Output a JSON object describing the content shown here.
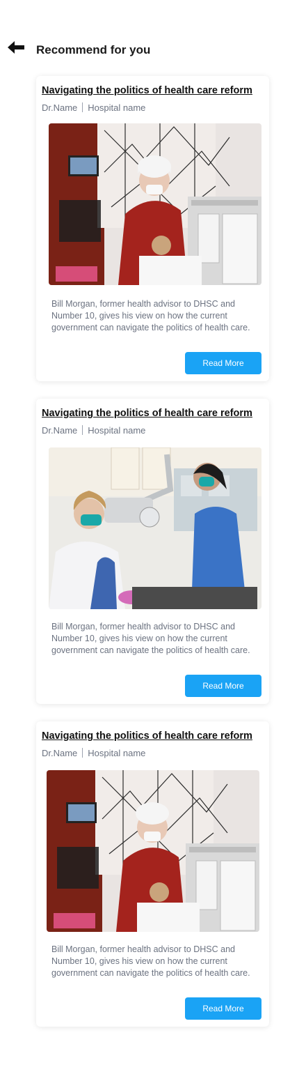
{
  "header": {
    "title": "Recommend for you",
    "back_icon": "arrow-left-icon"
  },
  "articles": [
    {
      "title": "Navigating the politics of health care reform",
      "doctor": "Dr.Name",
      "hospital": "Hospital name",
      "image": "dental-clinic-photo-1",
      "description": "Bill Morgan, former health advisor to DHSC and Number 10, gives his view on how the current government can navigate the politics of health care.",
      "button_label": "Read More"
    },
    {
      "title": "Navigating the politics of health care reform",
      "doctor": "Dr.Name",
      "hospital": "Hospital name",
      "image": "dental-clinic-photo-2",
      "description": "Bill Morgan, former health advisor to DHSC and Number 10, gives his view on how the current government can navigate the politics of health care.",
      "button_label": "Read More"
    },
    {
      "title": "Navigating the politics of health care reform",
      "doctor": "Dr.Name",
      "hospital": "Hospital name",
      "image": "dental-clinic-photo-1",
      "description": "Bill Morgan, former health advisor to DHSC and Number 10, gives his view on how the current government can navigate the politics of health care.",
      "button_label": "Read More"
    }
  ],
  "colors": {
    "accent": "#1aa3f5",
    "muted_text": "#6b7280"
  }
}
